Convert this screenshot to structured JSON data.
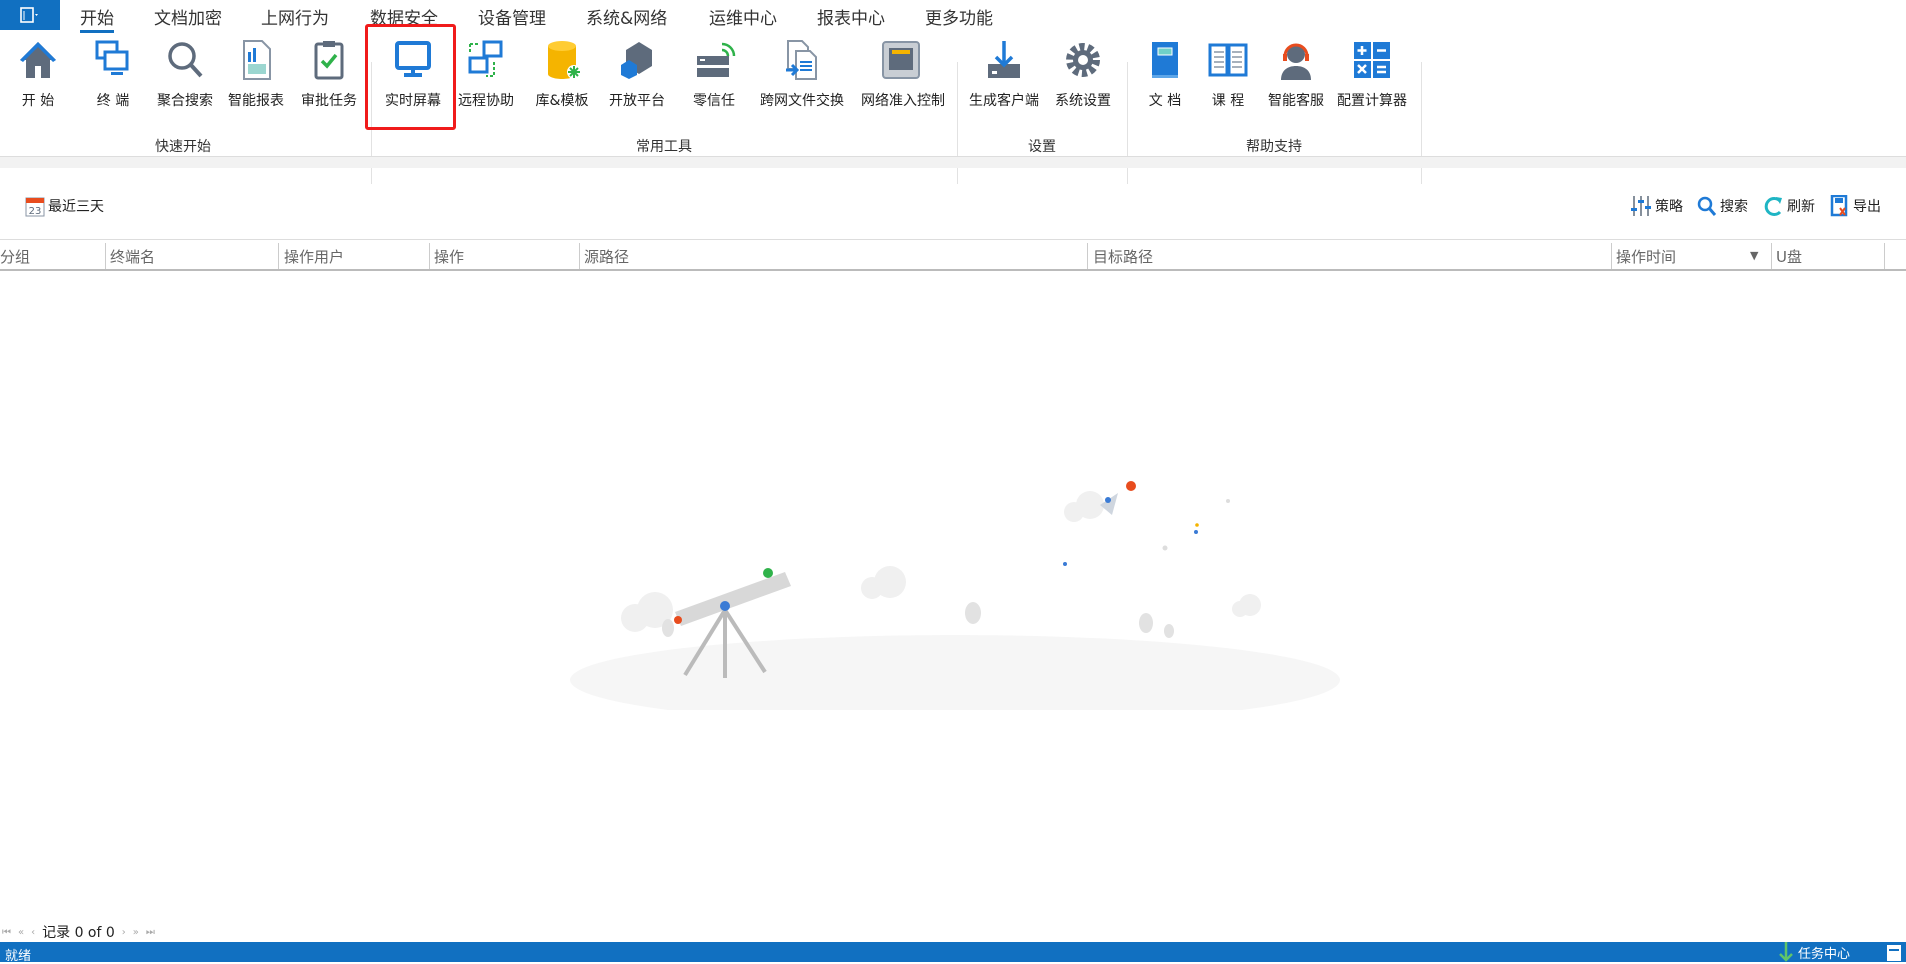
{
  "menubar": {
    "tabs": [
      "开始",
      "文档加密",
      "上网行为",
      "数据安全",
      "设备管理",
      "系统&网络",
      "运维中心",
      "报表中心",
      "更多功能"
    ],
    "active": "开始"
  },
  "ribbon": {
    "items": [
      "开 始",
      "终 端",
      "聚合搜索",
      "智能报表",
      "审批任务",
      "实时屏幕",
      "远程协助",
      "库&模板",
      "开放平台",
      "零信任",
      "跨网文件交换",
      "网络准入控制",
      "生成客户端",
      "系统设置",
      "文 档",
      "课 程",
      "智能客服",
      "配置计算器"
    ],
    "groups": [
      "快速开始",
      "常用工具",
      "设置",
      "帮助支持"
    ],
    "highlighted": "实时屏幕"
  },
  "toolbar": {
    "date_filter": "最近三天",
    "strategy": "策略",
    "search": "搜索",
    "refresh": "刷新",
    "export": "导出"
  },
  "table": {
    "columns": [
      "分组",
      "终端名",
      "操作用户",
      "操作",
      "源路径",
      "目标路径",
      "操作时间",
      "U盘"
    ],
    "rows": []
  },
  "pager": {
    "text": "记录 0 of 0"
  },
  "status": {
    "left": "就绪",
    "task_center": "任务中心"
  },
  "colors": {
    "accent": "#1170c1",
    "highlight": "#f01b1b"
  }
}
